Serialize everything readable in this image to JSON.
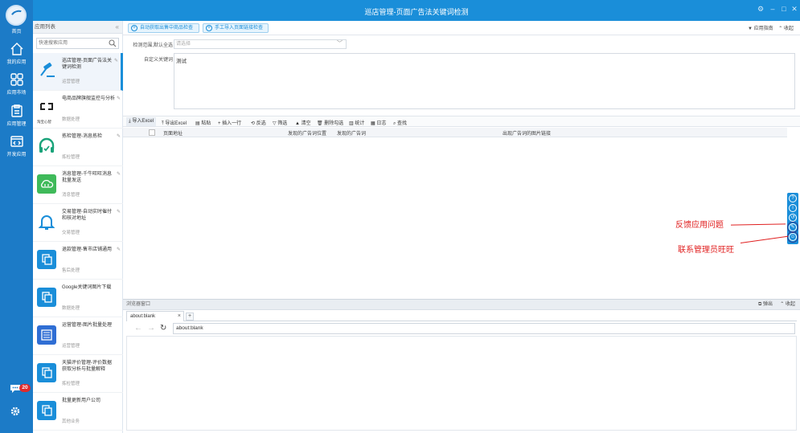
{
  "window": {
    "title": "巡店管理-页面广告法关键词检测"
  },
  "rail": {
    "home_label": "首页",
    "nav": [
      {
        "label": "我的应用"
      },
      {
        "label": "应用市场"
      },
      {
        "label": "应用管理"
      },
      {
        "label": "开发应用"
      }
    ],
    "chat_badge": "20"
  },
  "applist": {
    "title": "应用列表",
    "search_placeholder": "快速搜索应用",
    "items": [
      {
        "name": "巡店管理-页面广告法关键词检测",
        "category": "运营管理",
        "color": "#ffffff"
      },
      {
        "name": "电商品牌旗舰监控与分析",
        "category": "数据处理",
        "color": "#ffffff"
      },
      {
        "name": "拣检管理-消息拣检",
        "category": "拣检管理",
        "color": "#1aa37a"
      },
      {
        "name": "消息管理-千牛旺旺消息批量发送",
        "category": "消息管理",
        "color": "#3fba5a"
      },
      {
        "name": "交易管理-自动实时催付和核对地址",
        "category": "交易管理",
        "color": "#1a8ed9"
      },
      {
        "name": "退款管理-售市店铺通用",
        "category": "售后处理",
        "color": "#1a8ed9"
      },
      {
        "name": "Google关键词图片下载",
        "category": "数据处理",
        "color": "#1a8ed9"
      },
      {
        "name": "运营管理-图片批量处理",
        "category": "运营管理",
        "color": "#2f6ed4"
      },
      {
        "name": "天猫评价管理-评价数据获取分析与批量解释",
        "category": "拣检管理",
        "color": "#1a8ed9"
      },
      {
        "name": "批量更新用户公司",
        "category": "其他业务",
        "color": "#1a8ed9"
      }
    ],
    "logo_text": "淘宝心智"
  },
  "toolbar1": {
    "btn1": "自动获取出售中商品检查",
    "btn2": "手工导入页面链接检查",
    "app_desc": "应用指南",
    "collapse": "收起"
  },
  "form": {
    "scope_label": "检测范围,默认全选",
    "scope_placeholder": "请选择",
    "keywords_label": "自定义关键词",
    "keywords_value": "测试"
  },
  "toolbar2": {
    "items": [
      "导入Excel",
      "导出Excel",
      "粘贴",
      "插入一行",
      "反选",
      "筛选",
      "清空",
      "删除勾选",
      "统计",
      "日志",
      "查找"
    ]
  },
  "grid": {
    "columns": [
      "页面地址",
      "发现的广告词位置",
      "发现的广告词",
      "出现广告词的图片链接"
    ]
  },
  "annotations": {
    "feedback": "反馈应用问题",
    "contact": "联系管理员旺旺"
  },
  "browser": {
    "title": "浏览器窗口",
    "popout": "弹出",
    "collapse": "收起",
    "tab_label": "about:blank",
    "url": "about:blank"
  }
}
